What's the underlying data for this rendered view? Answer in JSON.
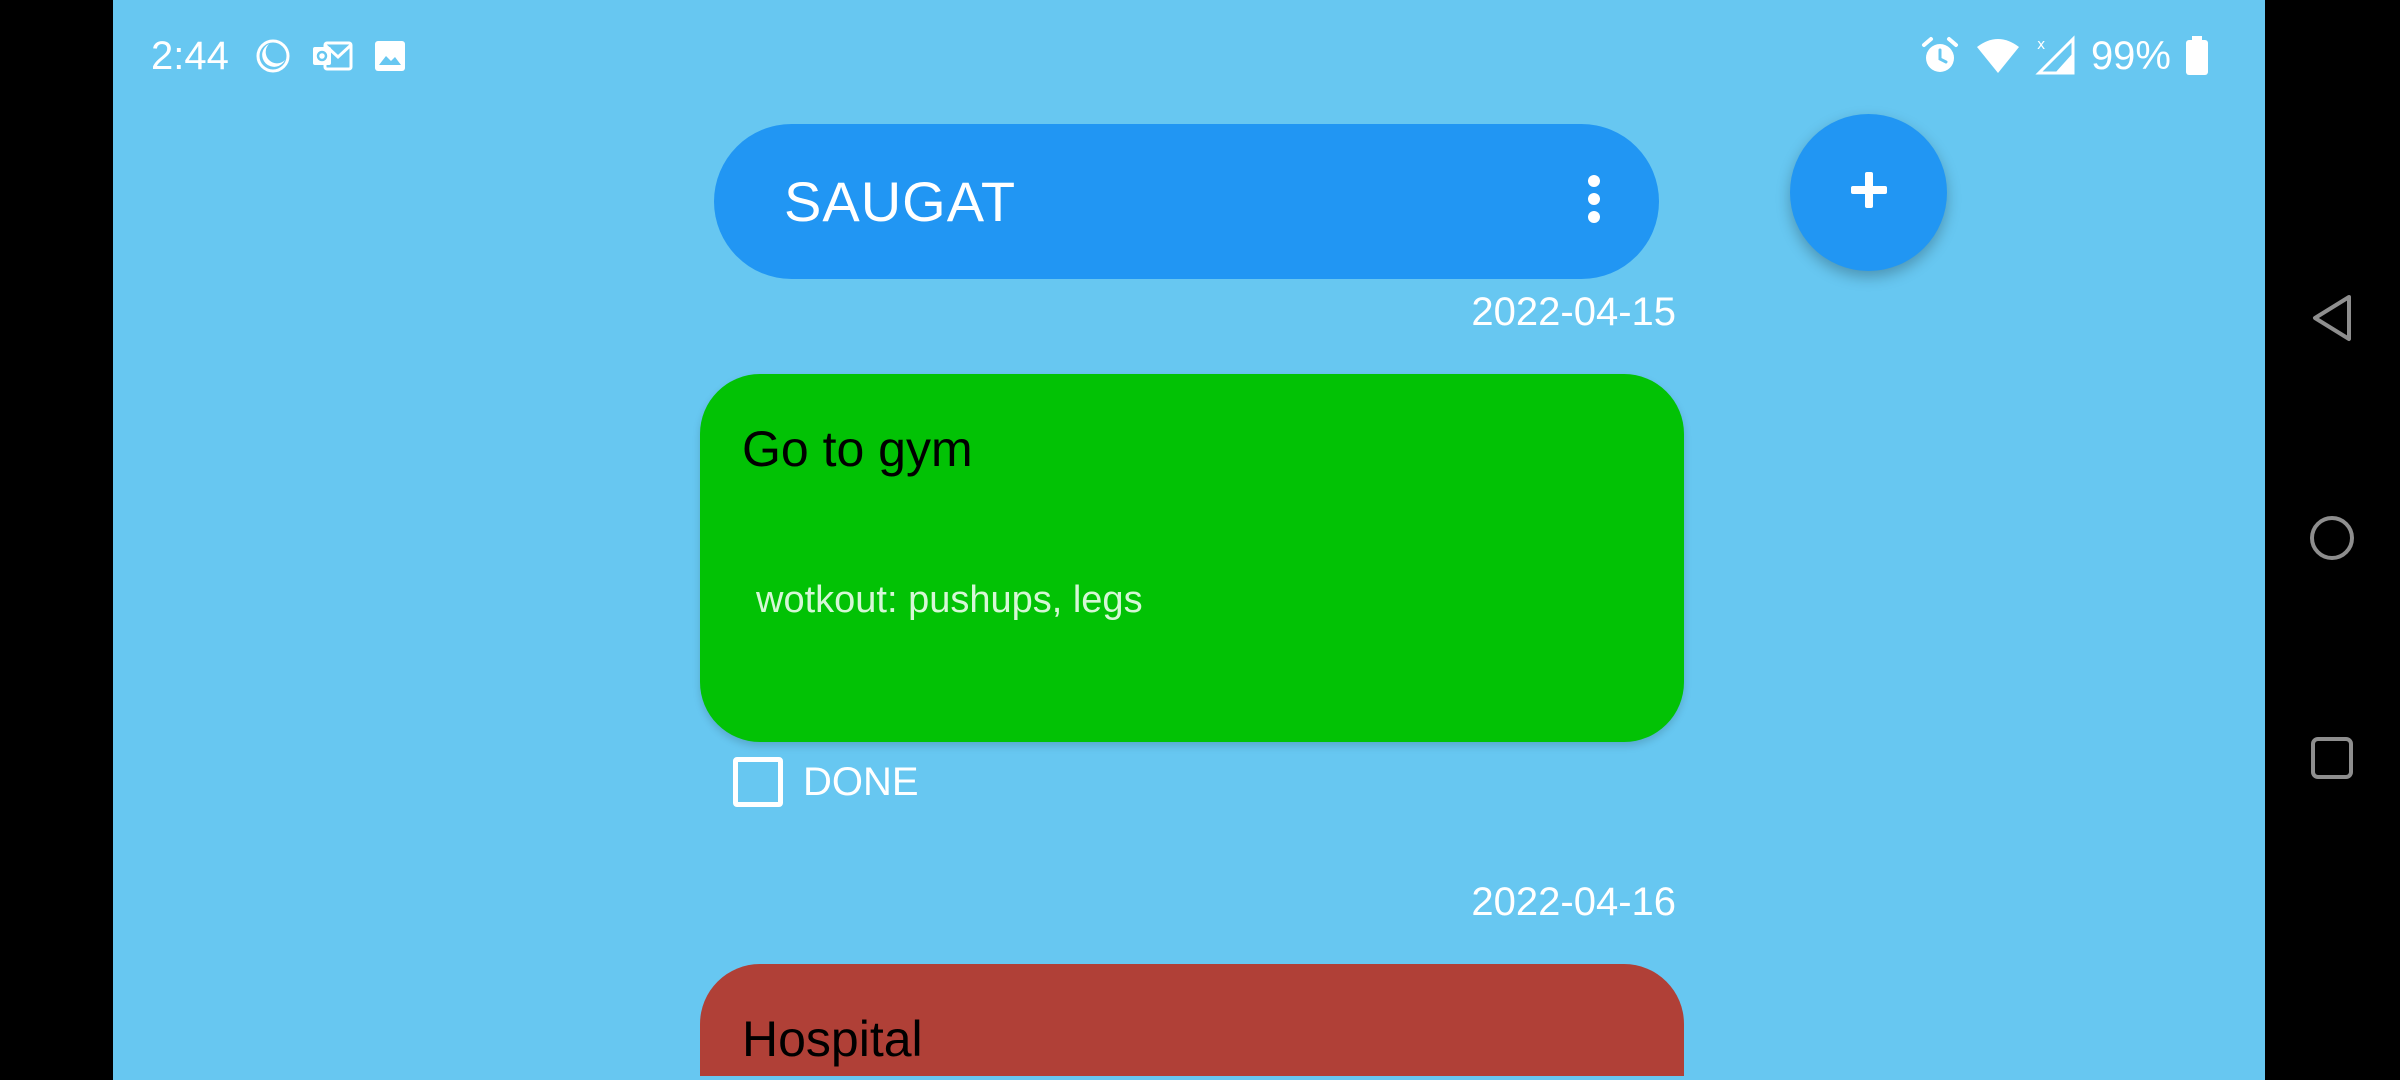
{
  "status_bar": {
    "time": "2:44",
    "battery": "99%",
    "left_icons": [
      "moon-icon",
      "outlook-icon",
      "image-icon"
    ],
    "right_icons": [
      "alarm-icon",
      "wifi-icon",
      "signal-icon",
      "battery-icon"
    ]
  },
  "app_bar": {
    "title": "SAUGAT",
    "menu_icon": "more-vert-icon"
  },
  "fab": {
    "icon": "plus-icon"
  },
  "tasks": [
    {
      "date": "2022-04-15",
      "title": "Go to gym",
      "description": "wotkout: pushups, legs",
      "color": "#02C205",
      "done_label": "DONE",
      "done_checked": false
    },
    {
      "date": "2022-04-16",
      "title": "Hospital",
      "color": "#B04037"
    }
  ],
  "colors": {
    "background": "#67C7F1",
    "accent": "#2196F3"
  },
  "nav_bar": {
    "icons": [
      "back-icon",
      "home-icon",
      "recents-icon"
    ]
  }
}
